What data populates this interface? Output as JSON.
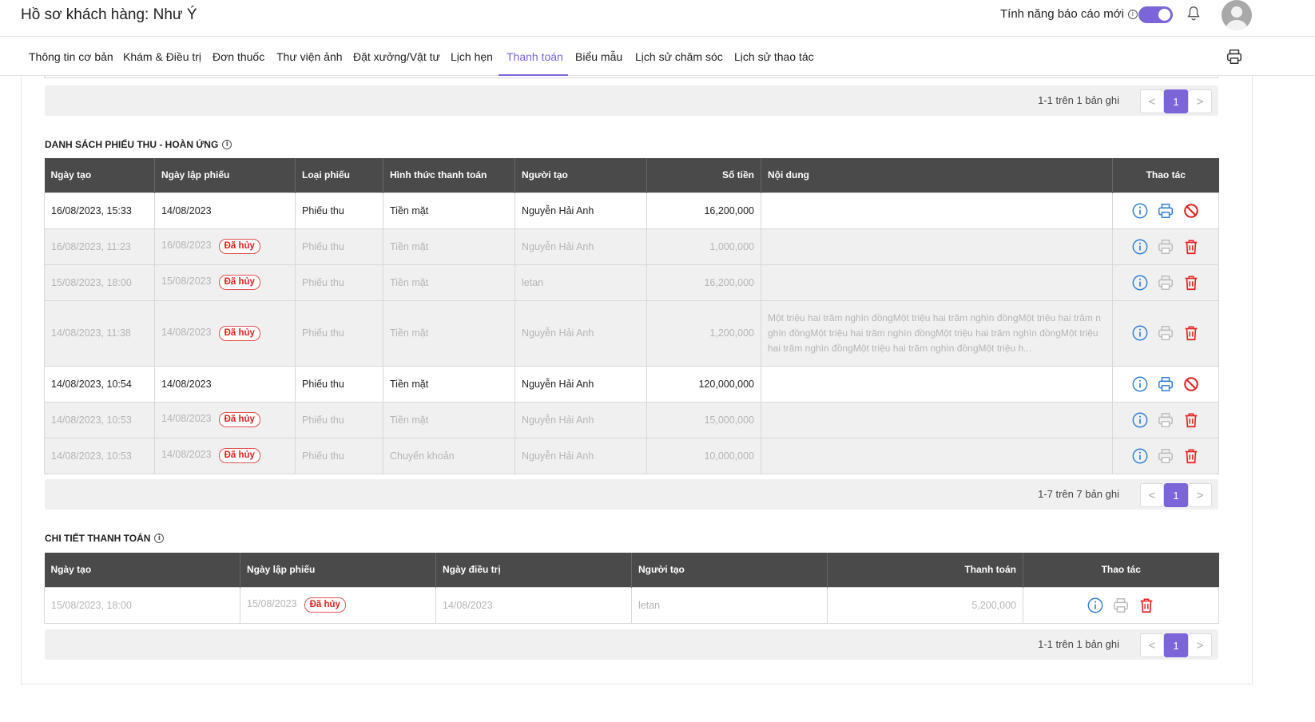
{
  "header": {
    "title": "Hồ sơ khách hàng: Như Ý",
    "feature_label": "Tính năng báo cáo mới",
    "feature_info": "i"
  },
  "tabs": [
    "Thông tin cơ bản",
    "Khám & Điều trị",
    "Đơn thuốc",
    "Thư viện ảnh",
    "Đặt xưởng/Vật tư",
    "Lịch hẹn",
    "Thanh toán",
    "Biểu mẫu",
    "Lịch sử chăm sóc",
    "Lịch sử thao tác"
  ],
  "active_tab": "Thanh toán",
  "pager_top": {
    "count": "1-1 trên 1 bản ghi",
    "prev": "<",
    "current": "1",
    "next": ">"
  },
  "receipts": {
    "title": "DANH SÁCH PHIẾU THU - HOÀN ỨNG",
    "info": "i",
    "columns": [
      "Ngày tạo",
      "Ngày lập phiếu",
      "Loại phiếu",
      "Hình thức thanh toán",
      "Người tạo",
      "Số tiền",
      "Nội dung",
      "Thao tác"
    ],
    "cancel_badge": "Đã hủy",
    "rows": [
      {
        "created": "16/08/2023, 15:33",
        "date": "14/08/2023",
        "type": "Phiếu thu",
        "method": "Tiền mặt",
        "creator": "Nguyễn Hải Anh",
        "amount": "16,200,000",
        "content": "",
        "cancelled": false
      },
      {
        "created": "16/08/2023, 11:23",
        "date": "16/08/2023",
        "type": "Phiếu thu",
        "method": "Tiền mặt",
        "creator": "Nguyễn Hải Anh",
        "amount": "1,000,000",
        "content": "",
        "cancelled": true
      },
      {
        "created": "15/08/2023, 18:00",
        "date": "15/08/2023",
        "type": "Phiếu thu",
        "method": "Tiền mặt",
        "creator": "letan",
        "amount": "16,200,000",
        "content": "",
        "cancelled": true
      },
      {
        "created": "14/08/2023, 11:38",
        "date": "14/08/2023",
        "type": "Phiếu thu",
        "method": "Tiền mặt",
        "creator": "Nguyễn Hải Anh",
        "amount": "1,200,000",
        "content": "Một triệu hai trăm nghìn đồngMột triệu hai trăm nghìn đồngMột triệu hai trăm nghìn đồngMột triệu hai trăm nghìn đồngMột triệu hai trăm nghìn đồngMột triệu hai trăm nghìn đồngMột triệu hai trăm nghìn đồngMột triệu h...",
        "cancelled": true
      },
      {
        "created": "14/08/2023, 10:54",
        "date": "14/08/2023",
        "type": "Phiếu thu",
        "method": "Tiền mặt",
        "creator": "Nguyễn Hải Anh",
        "amount": "120,000,000",
        "content": "",
        "cancelled": false
      },
      {
        "created": "14/08/2023, 10:53",
        "date": "14/08/2023",
        "type": "Phiếu thu",
        "method": "Tiền mặt",
        "creator": "Nguyễn Hải Anh",
        "amount": "15,000,000",
        "content": "",
        "cancelled": true
      },
      {
        "created": "14/08/2023, 10:53",
        "date": "14/08/2023",
        "type": "Phiếu thu",
        "method": "Chuyển khoản",
        "creator": "Nguyễn Hải Anh",
        "amount": "10,000,000",
        "content": "",
        "cancelled": true
      }
    ]
  },
  "pager_receipts": {
    "count": "1-7 trên 7 bản ghi",
    "prev": "<",
    "current": "1",
    "next": ">"
  },
  "payment_detail": {
    "title": "CHI TIẾT THANH TOÁN",
    "info": "i",
    "columns": [
      "Ngày tạo",
      "Ngày lập phiếu",
      "Ngày điều trị",
      "Người tạo",
      "Thanh toán",
      "Thao tác"
    ],
    "cancel_badge": "Đã hủy",
    "rows": [
      {
        "created": "15/08/2023, 18:00",
        "date": "15/08/2023",
        "treatment_date": "14/08/2023",
        "creator": "letan",
        "amount": "5,200,000",
        "cancelled": true
      }
    ]
  },
  "pager_detail": {
    "count": "1-1 trên 1 bản ghi",
    "prev": "<",
    "current": "1",
    "next": ">"
  },
  "icons": [
    "bell-icon",
    "avatar",
    "printer-icon",
    "info-icon",
    "print-icon",
    "cancel-icon",
    "delete-icon"
  ],
  "colors": {
    "accent": "#7c65d8",
    "danger": "#e02020",
    "header_dark": "#4a4a4a",
    "info_blue": "#2f7fd6"
  }
}
